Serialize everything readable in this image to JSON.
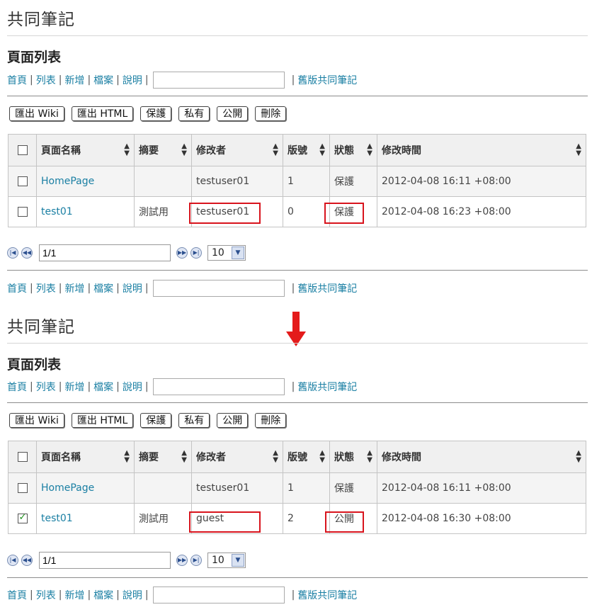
{
  "accent_link_color": "#1a7fa3",
  "highlight_color": "#d8141d",
  "wiki_title": "共同筆記",
  "section_title": "頁面列表",
  "nav": {
    "home": "首頁",
    "list": "列表",
    "new": "新增",
    "files": "檔案",
    "help": "說明",
    "separator": "|",
    "old_version": "舊版共同筆記",
    "search_value": ""
  },
  "toolbar": {
    "export_wiki": "匯出 Wiki",
    "export_html": "匯出 HTML",
    "protect": "保護",
    "private": "私有",
    "public": "公開",
    "delete": "刪除"
  },
  "columns": {
    "name": "頁面名稱",
    "summary": "摘要",
    "modifier": "修改者",
    "version": "版號",
    "status": "狀態",
    "modified_time": "修改時間"
  },
  "sort_icon": "sort-arrows-icon",
  "before": {
    "rows": [
      {
        "checked": false,
        "name": "HomePage",
        "summary": "",
        "modifier": "testuser01",
        "version": "1",
        "status": "保護",
        "time": "2012-04-08 16:11 +08:00"
      },
      {
        "checked": false,
        "name": "test01",
        "summary": "測試用",
        "modifier": "testuser01",
        "version": "0",
        "status": "保護",
        "time": "2012-04-08 16:23 +08:00"
      }
    ],
    "page_value": "1/1",
    "page_size": "10"
  },
  "after": {
    "rows": [
      {
        "checked": false,
        "name": "HomePage",
        "summary": "",
        "modifier": "testuser01",
        "version": "1",
        "status": "保護",
        "time": "2012-04-08 16:11 +08:00"
      },
      {
        "checked": true,
        "name": "test01",
        "summary": "測試用",
        "modifier": "guest",
        "version": "2",
        "status": "公開",
        "time": "2012-04-08 16:30 +08:00"
      }
    ],
    "page_value": "1/1",
    "page_size": "10"
  },
  "transition_icon": "down-arrow-icon"
}
